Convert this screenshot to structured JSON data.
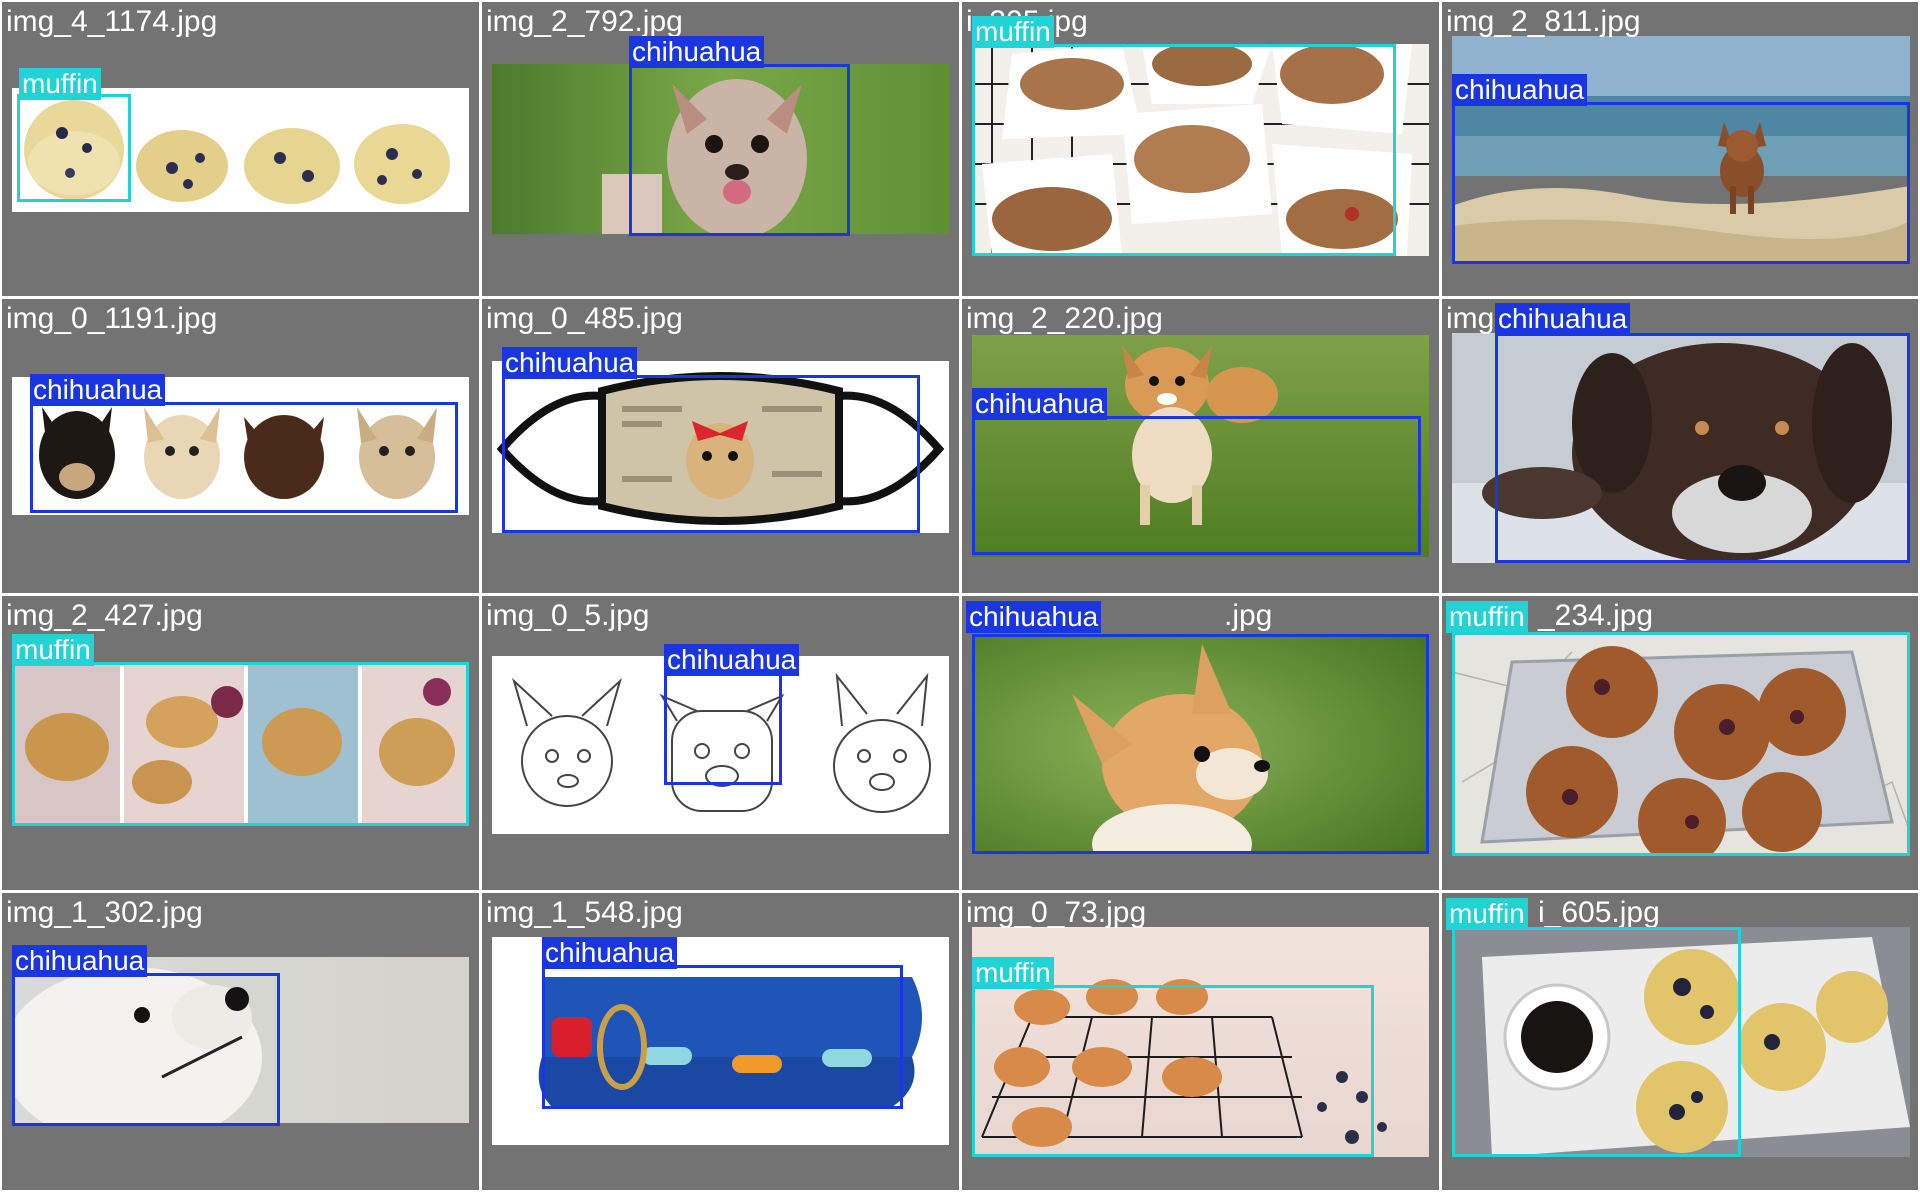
{
  "colors": {
    "background": "#737373",
    "divider": "#ffffff",
    "chihuahua": "#1a36e0",
    "muffin": "#22d3d6"
  },
  "tiles": [
    {
      "filename": "img_4_1174.jpg",
      "image": "four blueberry muffin halves on white background",
      "detections": [
        {
          "label": "muffin",
          "class": "muffin"
        }
      ]
    },
    {
      "filename": "img_2_792.jpg",
      "image": "chihuahua licking its nose on green grass",
      "detections": [
        {
          "label": "chihuahua",
          "class": "chihuahua"
        }
      ]
    },
    {
      "filename": "i_305.jpg",
      "image": "muffins in paper wrappers on cooling rack",
      "detections": [
        {
          "label": "muffin",
          "class": "muffin"
        }
      ]
    },
    {
      "filename": "img_2_811.jpg",
      "image": "small chihuahua standing on rocks by the sea",
      "detections": [
        {
          "label": "chihuahua",
          "class": "chihuahua"
        }
      ]
    },
    {
      "filename": "img_0_1191.jpg",
      "image": "row of four chihuahua heads",
      "detections": [
        {
          "label": "chihuahua",
          "class": "chihuahua"
        }
      ]
    },
    {
      "filename": "img_0_485.jpg",
      "image": "face mask printed with chihuahua wearing red bow",
      "detections": [
        {
          "label": "chihuahua",
          "class": "chihuahua"
        }
      ]
    },
    {
      "filename": "img_2_220.jpg",
      "image": "long-haired chihuahua running on grass",
      "detections": [
        {
          "label": "chihuahua",
          "class": "chihuahua"
        }
      ]
    },
    {
      "filename": "img",
      "image": "old dark brown dog lying down",
      "detections": [
        {
          "label": "chihuahua",
          "class": "chihuahua"
        }
      ]
    },
    {
      "filename": "img_2_427.jpg",
      "image": "collage of almond muffins on pink paper",
      "detections": [
        {
          "label": "muffin",
          "class": "muffin"
        }
      ]
    },
    {
      "filename": "img_0_5.jpg",
      "image": "line sketches of three dog heads",
      "detections": [
        {
          "label": "chihuahua",
          "class": "chihuahua"
        }
      ]
    },
    {
      "filename": ".jpg",
      "image": "chihuahua looking sideways on grass",
      "detections": [
        {
          "label": "chihuahua",
          "class": "chihuahua"
        }
      ]
    },
    {
      "filename": "_234.jpg",
      "image": "blueberry muffins on wire basket",
      "detections": [
        {
          "label": "muffin",
          "class": "muffin"
        }
      ]
    },
    {
      "filename": "img_1_302.jpg",
      "image": "white fluffy dog looking up",
      "detections": [
        {
          "label": "chihuahua",
          "class": "chihuahua"
        }
      ]
    },
    {
      "filename": "img_1_548.jpg",
      "image": "blue dog collar with colorful bone pattern",
      "detections": [
        {
          "label": "chihuahua",
          "class": "chihuahua"
        }
      ]
    },
    {
      "filename": "img_0_73.jpg",
      "image": "muffins on black wire rack with blueberries",
      "detections": [
        {
          "label": "muffin",
          "class": "muffin"
        }
      ]
    },
    {
      "filename": "i_605.jpg",
      "image": "coffee cup and blueberry muffins on white tray",
      "detections": [
        {
          "label": "muffin",
          "class": "muffin"
        }
      ]
    }
  ]
}
